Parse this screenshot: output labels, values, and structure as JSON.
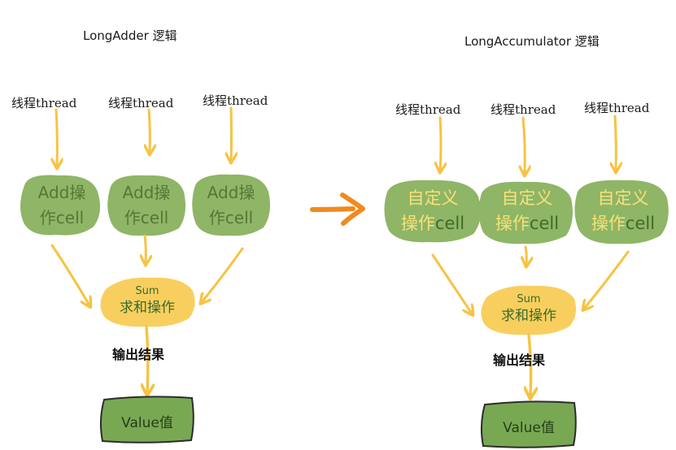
{
  "left": {
    "title": "LongAdder 逻辑",
    "threads": [
      {
        "cn": "线程",
        "en": "thread"
      },
      {
        "cn": "线程",
        "en": "thread"
      },
      {
        "cn": "线程",
        "en": "thread"
      }
    ],
    "cells": [
      {
        "line1": "Add操",
        "line2a": "作",
        "line2b": "cell"
      },
      {
        "line1": "Add操",
        "line2a": "作",
        "line2b": "cell"
      },
      {
        "line1": "Add操",
        "line2a": "作",
        "line2b": "cell"
      }
    ],
    "sum": {
      "line1": "Sum",
      "line2": "求和操作"
    },
    "result_label": "输出结果",
    "value_label": "Value值"
  },
  "right": {
    "title": "LongAccumulator 逻辑",
    "threads": [
      {
        "cn": "线程",
        "en": "thread"
      },
      {
        "cn": "线程",
        "en": "thread"
      },
      {
        "cn": "线程",
        "en": "thread"
      }
    ],
    "cells": [
      {
        "line1": "自定义",
        "line2a": "操作",
        "line2b": "cell"
      },
      {
        "line1": "自定义",
        "line2a": "操作",
        "line2b": "cell"
      },
      {
        "line1": "自定义",
        "line2a": "操作",
        "line2b": "cell"
      }
    ],
    "sum": {
      "line1": "Sum",
      "line2": "求和操作"
    },
    "result_label": "输出结果",
    "value_label": "Value值"
  },
  "colors": {
    "cell_green": "#8fb566",
    "sum_yellow": "#f8cf5f",
    "arrow_yellow": "#f7c343",
    "value_green": "#79a853",
    "transition_arrow": "#f08a1c"
  }
}
